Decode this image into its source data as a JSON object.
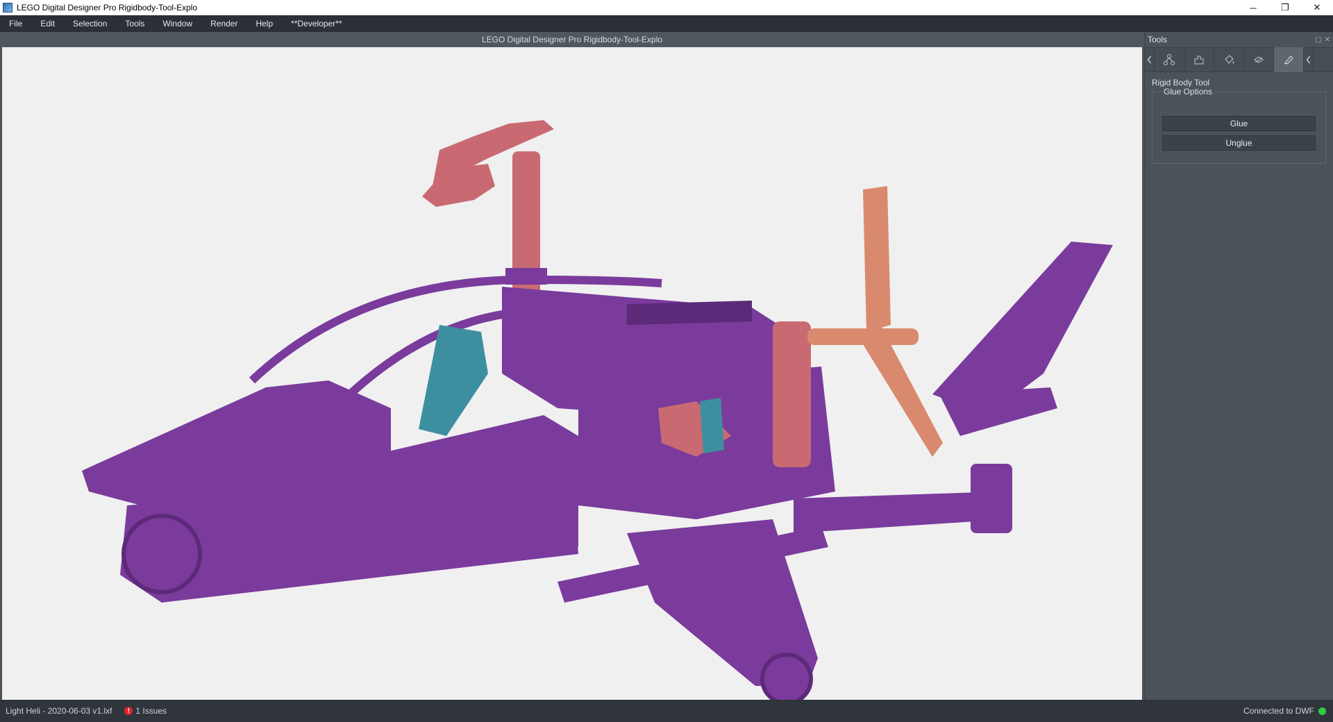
{
  "window": {
    "title": "LEGO Digital Designer Pro Rigidbody-Tool-Explo",
    "minimize": "─",
    "restore": "❐",
    "close": "✕"
  },
  "menu": {
    "items": [
      "File",
      "Edit",
      "Selection",
      "Tools",
      "Window",
      "Render",
      "Help",
      "**Developer**"
    ]
  },
  "viewport": {
    "title": "LEGO Digital Designer Pro Rigidbody-Tool-Explo",
    "colors": {
      "purple": "#7a3b9c",
      "purple_dark": "#5c2a78",
      "salmon": "#c96a73",
      "orange": "#d98a6e",
      "teal": "#3d8fa0",
      "background": "#f0f0f0"
    }
  },
  "tools": {
    "header": "Tools",
    "tabs": [
      "hinge-tool-icon",
      "connection-tool-icon",
      "flex-tool-icon",
      "paint-tool-icon",
      "hide-tool-icon",
      "rigid-body-tool-icon"
    ],
    "active_tab": 5,
    "panel_title": "Rigid Body Tool",
    "group_title": "Glue Options",
    "glue_label": "Glue",
    "unglue_label": "Unglue"
  },
  "status": {
    "file": "Light Heli - 2020-06-03 v1.lxf",
    "issue_icon": "!",
    "issues": "1 Issues",
    "connection": "Connected to DWF",
    "connection_color": "#2ecc40"
  }
}
